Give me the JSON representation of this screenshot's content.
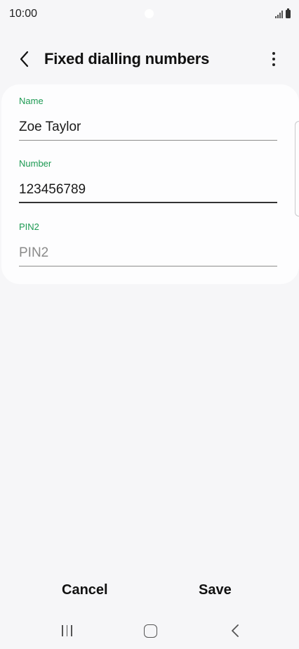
{
  "status_bar": {
    "time": "10:00"
  },
  "header": {
    "title": "Fixed dialling numbers"
  },
  "form": {
    "name": {
      "label": "Name",
      "value": "Zoe Taylor"
    },
    "number": {
      "label": "Number",
      "value": "123456789"
    },
    "pin2": {
      "label": "PIN2",
      "placeholder": "PIN2"
    }
  },
  "actions": {
    "cancel": "Cancel",
    "save": "Save"
  },
  "colors": {
    "accent_label": "#1d9a53",
    "background": "#f6f6f8",
    "card": "#fdfdfe"
  }
}
